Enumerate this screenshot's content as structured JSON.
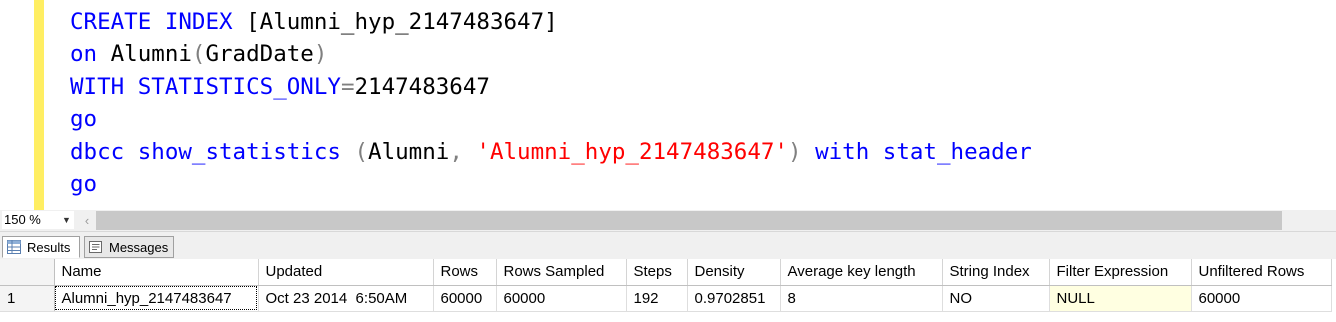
{
  "editor": {
    "lines": [
      [
        {
          "t": "CREATE INDEX ",
          "c": "kw"
        },
        {
          "t": "[Alumni_hyp_2147483647]",
          "c": "plain"
        }
      ],
      [
        {
          "t": "on ",
          "c": "kw"
        },
        {
          "t": "Alumni",
          "c": "plain"
        },
        {
          "t": "(",
          "c": "op"
        },
        {
          "t": "GradDate",
          "c": "plain"
        },
        {
          "t": ")",
          "c": "op"
        }
      ],
      [
        {
          "t": "WITH ",
          "c": "kw"
        },
        {
          "t": "STATISTICS_ONLY",
          "c": "kw"
        },
        {
          "t": "=",
          "c": "op"
        },
        {
          "t": "2147483647",
          "c": "plain"
        }
      ],
      [
        {
          "t": "go",
          "c": "kw"
        }
      ],
      [
        {
          "t": "dbcc ",
          "c": "kw"
        },
        {
          "t": "show_statistics ",
          "c": "kw"
        },
        {
          "t": "(",
          "c": "op"
        },
        {
          "t": "Alumni",
          "c": "plain"
        },
        {
          "t": ", ",
          "c": "op"
        },
        {
          "t": "'Alumni_hyp_2147483647'",
          "c": "str"
        },
        {
          "t": ") ",
          "c": "op"
        },
        {
          "t": "with ",
          "c": "kw"
        },
        {
          "t": "stat_header",
          "c": "kw"
        }
      ],
      [
        {
          "t": "go",
          "c": "kw"
        }
      ]
    ]
  },
  "zoom": {
    "value": "150 %"
  },
  "tabs": {
    "results_label": "Results",
    "messages_label": "Messages"
  },
  "grid": {
    "columns": [
      "Name",
      "Updated",
      "Rows",
      "Rows Sampled",
      "Steps",
      "Density",
      "Average key length",
      "String Index",
      "Filter Expression",
      "Unfiltered Rows"
    ],
    "rows": [
      {
        "row_number": "1",
        "cells": [
          "Alumni_hyp_2147483647",
          "Oct 23 2014  6:50AM",
          "60000",
          "60000",
          "192",
          "0.9702851",
          "8",
          "NO",
          "NULL",
          "60000"
        ]
      }
    ]
  },
  "colors": {
    "keyword": "#0000ff",
    "operator": "#808080",
    "string": "#ff0000",
    "change_bar": "#ffee62",
    "null_cell": "#ffffe1"
  }
}
